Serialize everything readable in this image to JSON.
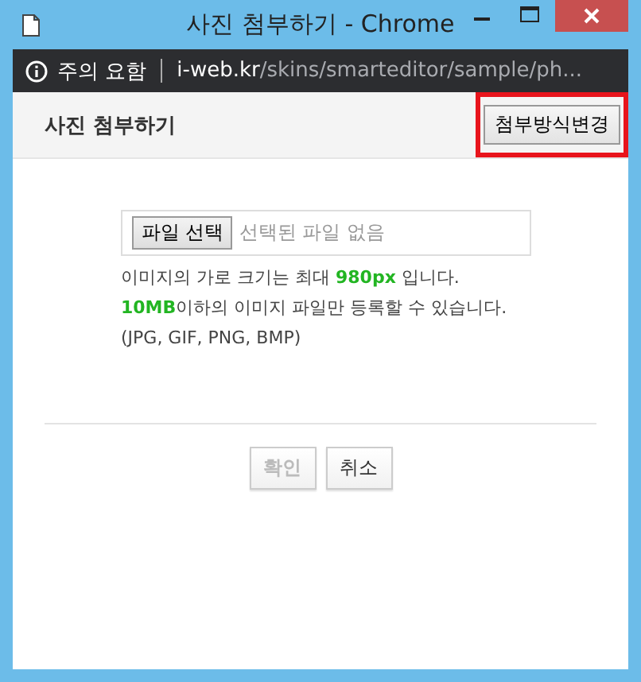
{
  "window": {
    "title": "사진 첨부하기 - Chrome"
  },
  "address_bar": {
    "security": "주의 요함",
    "domain": "i-web.kr",
    "path": "/skins/smarteditor/sample/ph..."
  },
  "header": {
    "title": "사진 첨부하기",
    "change_button": {
      "label": "첨부방식변경",
      "highlighted": true
    }
  },
  "file_input": {
    "button": "파일 선택",
    "status": "선택된 파일 없음"
  },
  "notes": [
    "이미지의 가로 크기는 최대 **980px** 입니다.",
    "**10MB**이하의 이미지 파일만 등록할 수 있습니다.",
    "(JPG, GIF, PNG, BMP)"
  ],
  "buttons": [
    {
      "label": "확인",
      "disabled": true
    },
    {
      "label": "취소",
      "disabled": false
    }
  ]
}
